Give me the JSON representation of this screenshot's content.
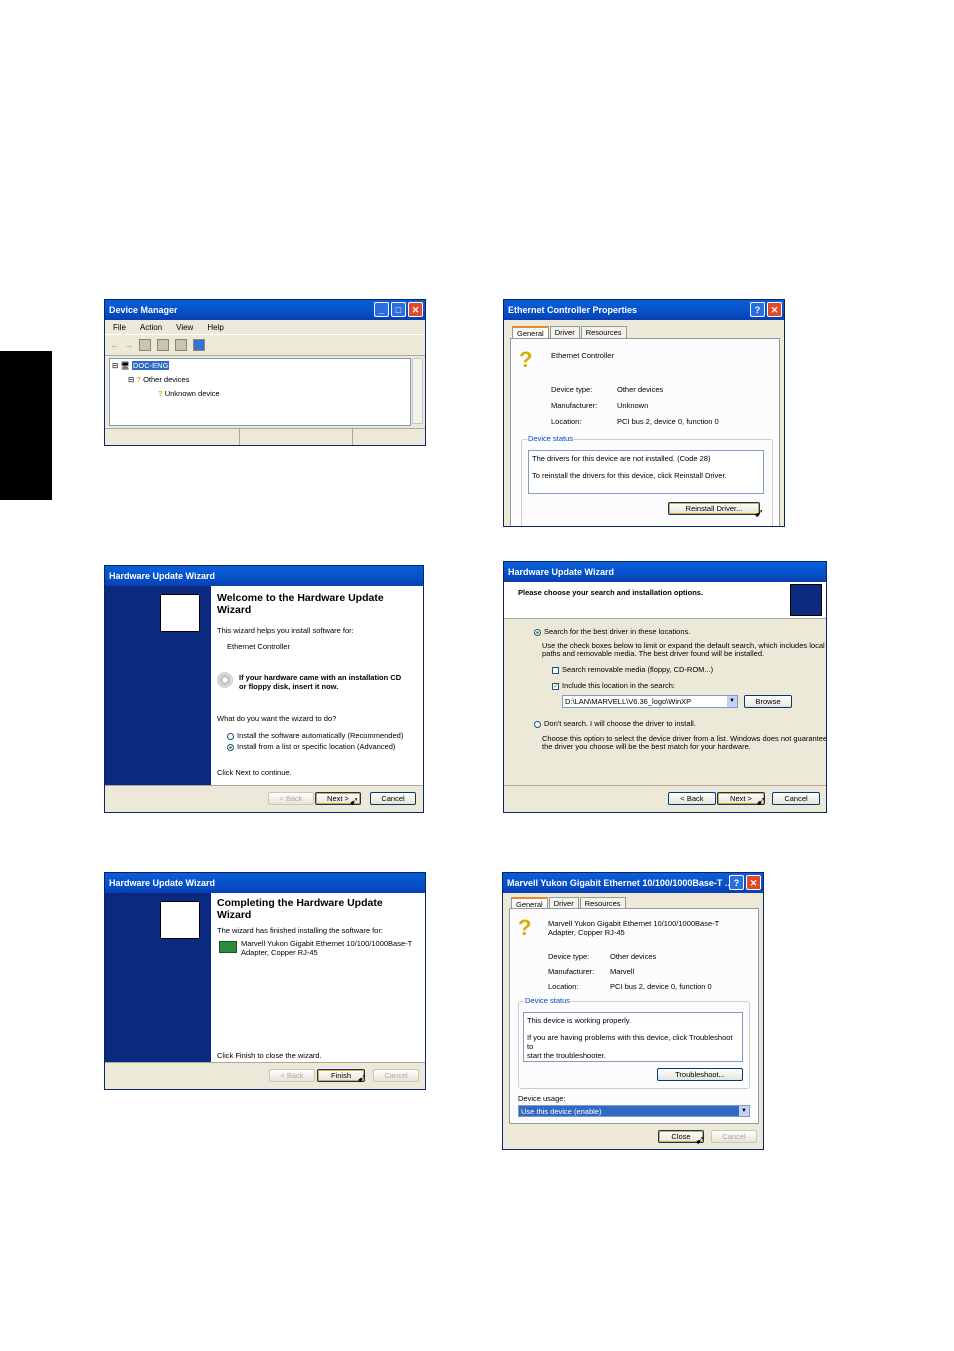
{
  "device_manager": {
    "title": "Device Manager",
    "menu": [
      "File",
      "Action",
      "View",
      "Help"
    ],
    "tree": {
      "root": "DOC-ENG",
      "group": "Other devices",
      "item": "Unknown device"
    }
  },
  "ethernet_props": {
    "title": "Ethernet Controller Properties",
    "tabs": [
      "General",
      "Driver",
      "Resources"
    ],
    "device_name": "Ethernet Controller",
    "labels": {
      "type": "Device type:",
      "manufacturer": "Manufacturer:",
      "location": "Location:"
    },
    "values": {
      "type": "Other devices",
      "manufacturer": "Unknown",
      "location": "PCI bus 2, device 0, function 0"
    },
    "status_label": "Device status",
    "status_line1": "The drivers for this device are not installed. (Code 28)",
    "status_line2": "To reinstall the drivers for this device, click Reinstall Driver.",
    "reinstall_button": "Reinstall Driver..."
  },
  "wizard_welcome": {
    "title": "Hardware Update Wizard",
    "heading_line1": "Welcome to the Hardware Update",
    "heading_line2": "Wizard",
    "intro": "This wizard helps you install software for:",
    "device": "Ethernet Controller",
    "cd_line1": "If your hardware came with an installation CD",
    "cd_line2": "or floppy disk, insert it now.",
    "question": "What do you want the wizard to do?",
    "option_auto": "Install the software automatically (Recommended)",
    "option_list": "Install from a list or specific location (Advanced)",
    "continue": "Click Next to continue.",
    "back": "< Back",
    "next": "Next >",
    "cancel": "Cancel"
  },
  "wizard_search": {
    "title": "Hardware Update Wizard",
    "header": "Please choose your search and installation options.",
    "option_search": "Search for the best driver in these locations.",
    "desc_line1": "Use the check boxes below to limit or expand the default search, which includes local",
    "desc_line2": "paths and removable media. The best driver found will be installed.",
    "check_removable": "Search removable media (floppy, CD-ROM...)",
    "check_include": "Include this location in the search:",
    "path": "D:\\LAN\\MARVELL\\V6.36_logo\\WinXP",
    "browse": "Browse",
    "option_dont": "Don't search. I will choose the driver to install.",
    "dont_line1": "Choose this option to select the device driver from a list.  Windows does not guarantee that",
    "dont_line2": "the driver you choose will be the best match for your hardware.",
    "back": "< Back",
    "next": "Next >",
    "cancel": "Cancel"
  },
  "wizard_complete": {
    "title": "Hardware Update Wizard",
    "heading_line1": "Completing the Hardware Update",
    "heading_line2": "Wizard",
    "intro": "The wizard has finished installing the software for:",
    "device_line1": "Marvell Yukon Gigabit Ethernet 10/100/1000Base-T",
    "device_line2": "Adapter, Copper RJ-45",
    "finish_text": "Click Finish to close the wizard.",
    "back": "< Back",
    "finish": "Finish",
    "cancel": "Cancel"
  },
  "marvell_props": {
    "title": "Marvell Yukon Gigabit Ethernet 10/100/1000Base-T ...",
    "tabs": [
      "General",
      "Driver",
      "Resources"
    ],
    "device_line1": "Marvell Yukon Gigabit Ethernet 10/100/1000Base-T",
    "device_line2": "Adapter, Copper RJ-45",
    "labels": {
      "type": "Device type:",
      "manufacturer": "Manufacturer:",
      "location": "Location:"
    },
    "values": {
      "type": "Other devices",
      "manufacturer": "Marvell",
      "location": "PCI bus 2, device 0, function 0"
    },
    "status_label": "Device status",
    "status_line1": "This device is working properly.",
    "status_line2": "If you are having problems with this device, click Troubleshoot to",
    "status_line3": "start the troubleshooter.",
    "troubleshoot": "Troubleshoot...",
    "usage_label": "Device usage:",
    "usage_value": "Use this device (enable)",
    "close": "Close",
    "cancel": "Cancel"
  }
}
